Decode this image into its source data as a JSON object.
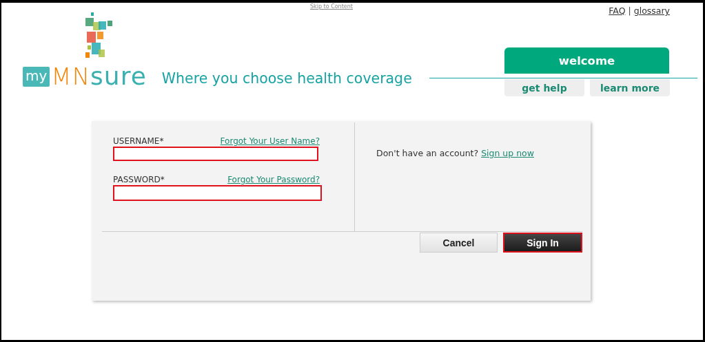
{
  "skip_link": "Skip to Content",
  "top_links": [
    {
      "label": "FAQ"
    },
    {
      "label": "glossary"
    }
  ],
  "top_links_separator": "|",
  "logo": {
    "my": "my",
    "mn": "MN",
    "sure": "sure"
  },
  "tagline": "Where you choose health coverage",
  "welcome_tab": "welcome",
  "help_buttons": [
    {
      "label": "get help"
    },
    {
      "label": "learn more"
    }
  ],
  "login": {
    "fields": [
      {
        "label": "USERNAME*",
        "link": "Forgot Your User Name?",
        "highlighted": true
      },
      {
        "label": "PASSWORD*",
        "link": "Forgot Your Password?",
        "highlighted": true
      }
    ],
    "signup_text": "Don't have an account?",
    "signup_link": "Sign up now",
    "buttons": [
      {
        "label": "Cancel",
        "kind": "secondary",
        "highlighted": false
      },
      {
        "label": "Sign In",
        "kind": "primary",
        "highlighted": true
      }
    ]
  }
}
